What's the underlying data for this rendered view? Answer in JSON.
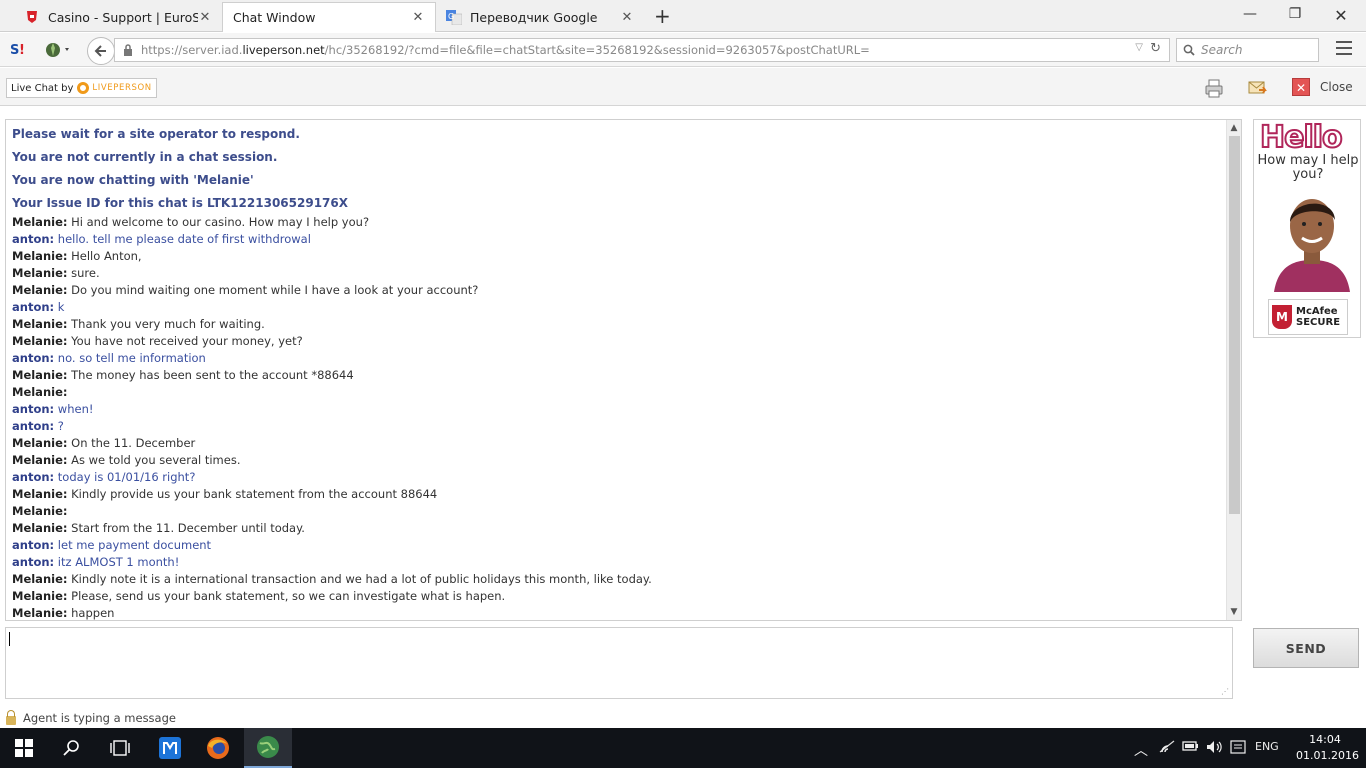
{
  "browser": {
    "tabs": [
      {
        "title": "Casino - Support | EuroSlots",
        "active": false
      },
      {
        "title": "Chat Window",
        "active": true
      },
      {
        "title": "Переводчик Google",
        "active": false
      }
    ],
    "url_prefix": "https://server.iad.",
    "url_domain": "liveperson.net",
    "url_suffix": "/hc/35268192/?cmd=file&file=chatStart&site=35268192&sessionid=9263057&postChatURL=",
    "search_placeholder": "Search"
  },
  "chat_toolbar": {
    "badge_text": "Live Chat by",
    "badge_brand": "LIVEPERSON",
    "close_label": "Close"
  },
  "system_messages": [
    "Please wait for a site operator to respond.",
    "You are not currently in a chat session.",
    "You are now chatting with 'Melanie'",
    "Your Issue ID for this chat is LTK1221306529176X"
  ],
  "messages": [
    {
      "who": "Melanie:",
      "text": "Hi and welcome to our casino. How may I help you?",
      "role": "agent"
    },
    {
      "who": "anton:",
      "text": "hello. tell me please date of first withdrowal",
      "role": "visitor"
    },
    {
      "who": "Melanie:",
      "text": "Hello Anton,",
      "role": "agent"
    },
    {
      "who": "Melanie:",
      "text": "sure.",
      "role": "agent"
    },
    {
      "who": "Melanie:",
      "text": "Do you mind waiting one moment while I have a look at your account?",
      "role": "agent"
    },
    {
      "who": "anton:",
      "text": "k",
      "role": "visitor"
    },
    {
      "who": "Melanie:",
      "text": "Thank you very much for waiting.",
      "role": "agent"
    },
    {
      "who": "Melanie:",
      "text": "You have not received your money, yet?",
      "role": "agent"
    },
    {
      "who": "anton:",
      "text": "no. so tell me information",
      "role": "visitor"
    },
    {
      "who": "Melanie:",
      "text": "The money has been sent to the account *88644",
      "role": "agent"
    },
    {
      "who": "Melanie:",
      "text": "",
      "role": "agent"
    },
    {
      "who": "anton:",
      "text": "when!",
      "role": "visitor"
    },
    {
      "who": "anton:",
      "text": "?",
      "role": "visitor"
    },
    {
      "who": "Melanie:",
      "text": "On the 11. December",
      "role": "agent"
    },
    {
      "who": "Melanie:",
      "text": "As we told you several times.",
      "role": "agent"
    },
    {
      "who": "anton:",
      "text": "today is 01/01/16 right?",
      "role": "visitor"
    },
    {
      "who": "Melanie:",
      "text": "Kindly provide us your bank statement from the account 88644",
      "role": "agent"
    },
    {
      "who": "Melanie:",
      "text": "",
      "role": "agent"
    },
    {
      "who": "Melanie:",
      "text": "Start from the 11. December until today.",
      "role": "agent"
    },
    {
      "who": "anton:",
      "text": "let me payment document",
      "role": "visitor"
    },
    {
      "who": "anton:",
      "text": "itz ALMOST 1 month!",
      "role": "visitor"
    },
    {
      "who": "Melanie:",
      "text": "Kindly note it is a international transaction and we had a lot of public holidays this month, like today.",
      "role": "agent"
    },
    {
      "who": "Melanie:",
      "text": "Please, send us your bank statement, so we can investigate what is hapen.",
      "role": "agent"
    },
    {
      "who": "Melanie:",
      "text": "happen",
      "role": "agent"
    }
  ],
  "ad": {
    "headline": "Hello",
    "subline": "How may I help you?",
    "badge": "McAfee SECURE"
  },
  "composer": {
    "value": "",
    "send_label": "SEND"
  },
  "status_text": "Agent is typing a message",
  "taskbar": {
    "language": "ENG",
    "time": "14:04",
    "date": "01.01.2016"
  },
  "colors": {
    "system_text": "#3d4d8c",
    "visitor_text": "#3a4fa0",
    "accent_orange": "#f09a1a",
    "ad_pink": "#b0265a"
  }
}
